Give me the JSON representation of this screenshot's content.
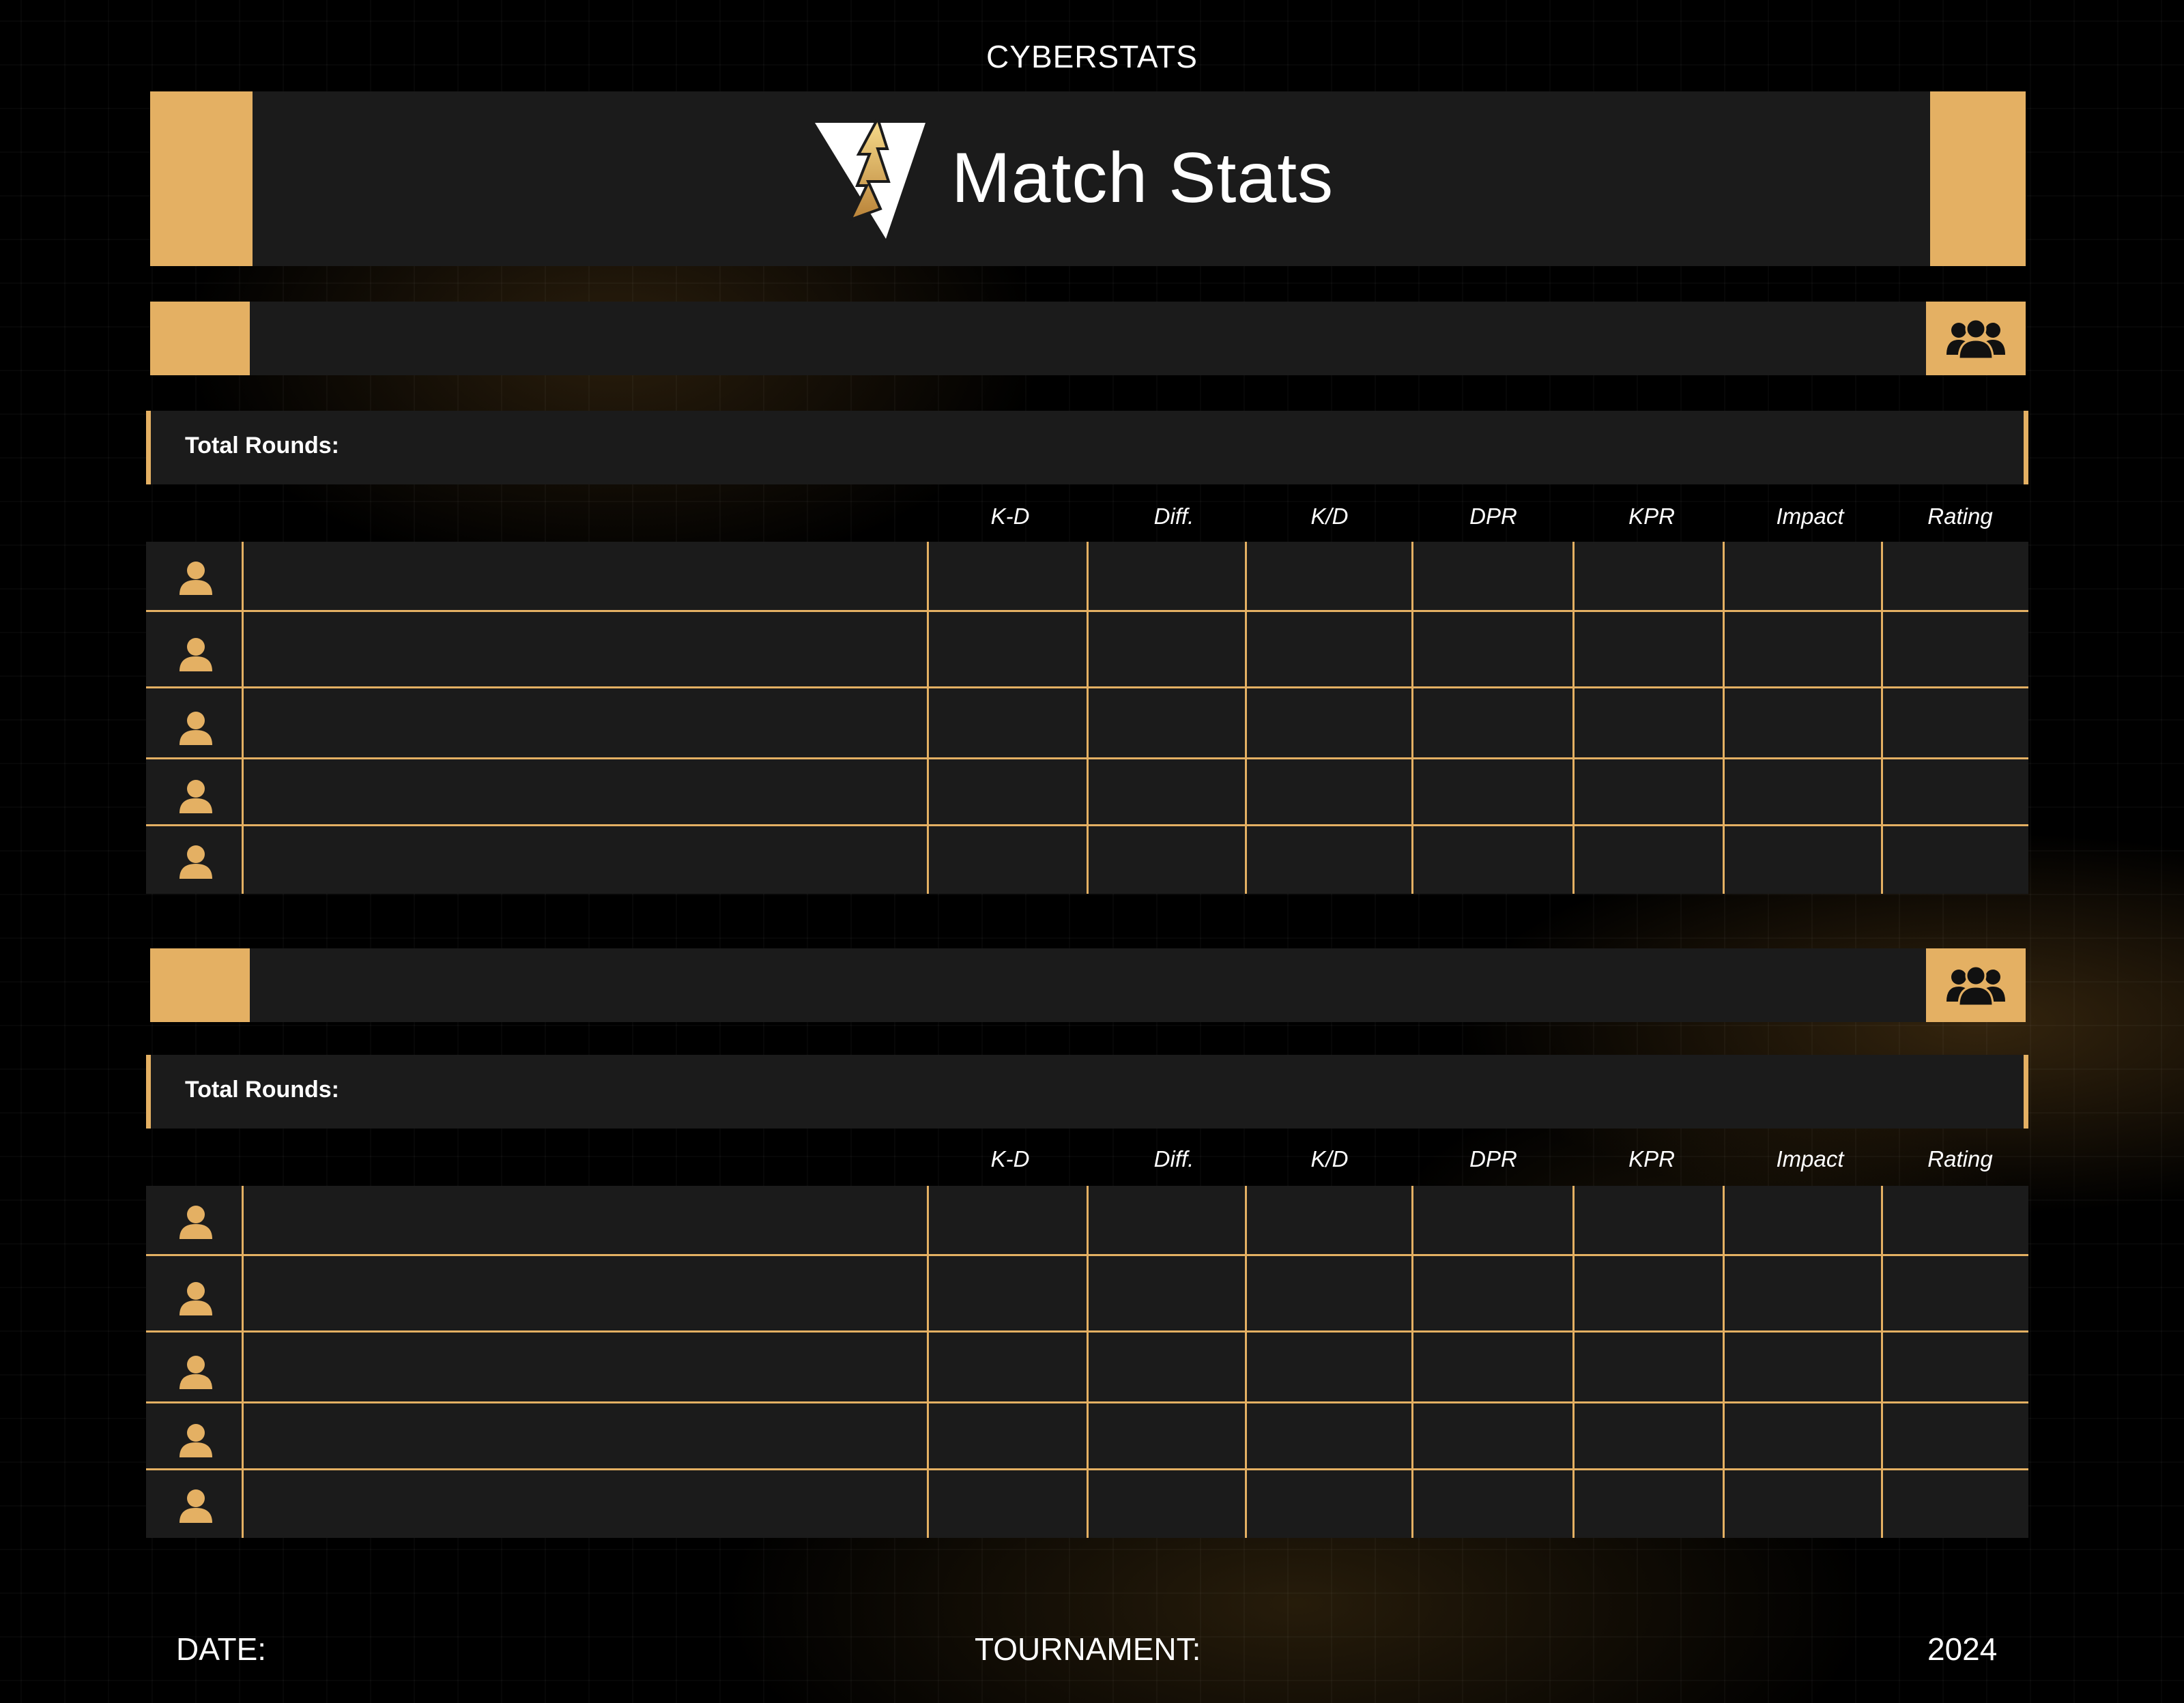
{
  "brand": "CYBERSTATS",
  "header": {
    "title": "Match Stats",
    "logo_icon": "lightning-triangle-icon"
  },
  "colors": {
    "accent": "#e4b063",
    "panel": "#1b1b1b",
    "background": "#000000"
  },
  "team1": {
    "team_icon": "team-group-icon",
    "total_rounds_label": "Total Rounds:",
    "columns": [
      "K-D",
      "Diff.",
      "K/D",
      "DPR",
      "KPR",
      "Impact",
      "Rating"
    ],
    "player_rows": 5,
    "player_icon": "player-avatar-icon"
  },
  "team2": {
    "team_icon": "team-group-icon",
    "total_rounds_label": "Total Rounds:",
    "columns": [
      "K-D",
      "Diff.",
      "K/D",
      "DPR",
      "KPR",
      "Impact",
      "Rating"
    ],
    "player_rows": 5,
    "player_icon": "player-avatar-icon"
  },
  "footer": {
    "date_label": "DATE:",
    "tournament_label": "TOURNAMENT:",
    "year": "2024"
  }
}
